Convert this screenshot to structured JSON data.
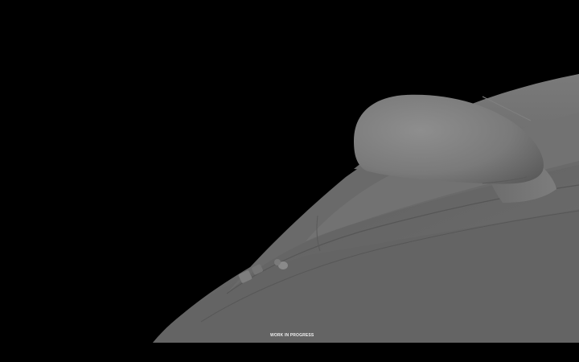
{
  "caption": "WORK IN PROGRESS",
  "render": {
    "subject": "untextured grey 3D car model close-up showing side mirror and A-pillar",
    "background_color": "#000000",
    "body_color": "#6b6b6b",
    "highlight_color": "#8c8c8c"
  }
}
